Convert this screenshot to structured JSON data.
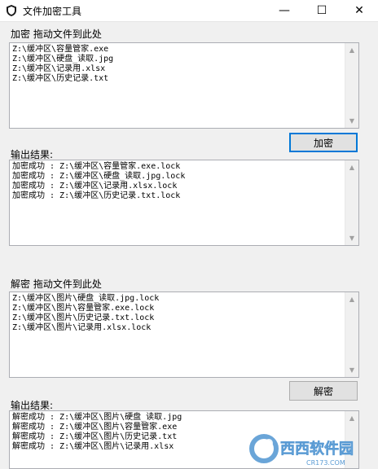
{
  "window": {
    "title": "文件加密工具",
    "controls": {
      "minimize": "—",
      "maximize": "☐",
      "close": "✕"
    }
  },
  "encrypt": {
    "group_label": "加密  拖动文件到此处",
    "files": [
      "Z:\\缓冲区\\容量管家.exe",
      "Z:\\缓冲区\\硬盘_读取.jpg",
      "Z:\\缓冲区\\记录用.xlsx",
      "Z:\\缓冲区\\历史记录.txt"
    ],
    "button_label": "加密",
    "output_label": "输出结果:",
    "output_lines": [
      "加密成功 : Z:\\缓冲区\\容量管家.exe.lock",
      "加密成功 : Z:\\缓冲区\\硬盘_读取.jpg.lock",
      "加密成功 : Z:\\缓冲区\\记录用.xlsx.lock",
      "加密成功 : Z:\\缓冲区\\历史记录.txt.lock"
    ]
  },
  "decrypt": {
    "group_label": "解密  拖动文件到此处",
    "files": [
      "Z:\\缓冲区\\图片\\硬盘_读取.jpg.lock",
      "Z:\\缓冲区\\图片\\容量管家.exe.lock",
      "Z:\\缓冲区\\图片\\历史记录.txt.lock",
      "Z:\\缓冲区\\图片\\记录用.xlsx.lock"
    ],
    "button_label": "解密",
    "output_label": "输出结果:",
    "output_lines": [
      "解密成功 : Z:\\缓冲区\\图片\\硬盘_读取.jpg",
      "解密成功 : Z:\\缓冲区\\图片\\容量管家.exe",
      "解密成功 : Z:\\缓冲区\\图片\\历史记录.txt",
      "解密成功 : Z:\\缓冲区\\图片\\记录用.xlsx"
    ]
  },
  "watermark": {
    "brand": "西西软件园",
    "url": "CR173.COM"
  },
  "icons": {
    "app": "shield-icon",
    "scroll_up": "chevron-up-icon",
    "scroll_down": "chevron-down-icon"
  },
  "colors": {
    "accent": "#0078d7",
    "window_bg": "#f0f0f0",
    "watermark": "#5a9bd4"
  }
}
